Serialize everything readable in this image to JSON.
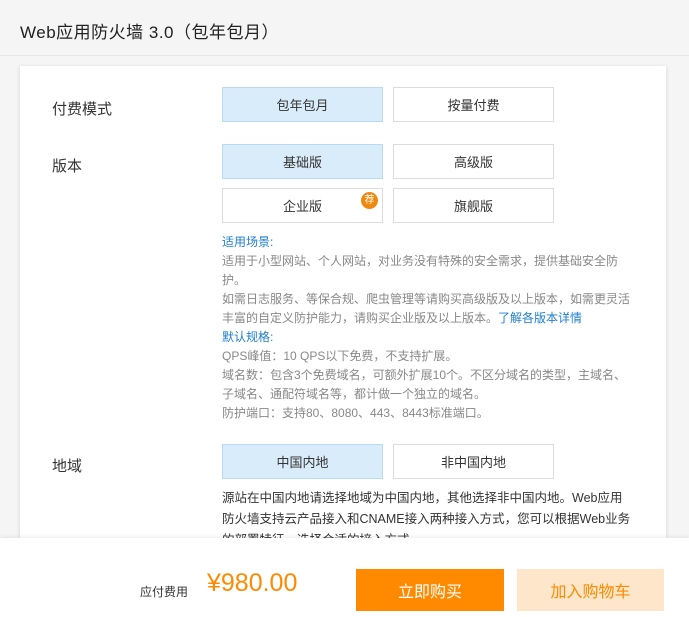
{
  "header": {
    "title": "Web应用防火墙 3.0（包年包月）"
  },
  "form": {
    "billing": {
      "label": "付费模式",
      "options": [
        "包年包月",
        "按量付费"
      ],
      "selected": "包年包月"
    },
    "edition": {
      "label": "版本",
      "options": [
        "基础版",
        "高级版",
        "企业版",
        "旗舰版"
      ],
      "selected": "基础版",
      "recommend_badge": "荐"
    },
    "edition_info": {
      "scenario_title": "适用场景:",
      "scenario_text": "适用于小型网站、个人网站，对业务没有特殊的安全需求，提供基础安全防护。",
      "upgrade_text": "如需日志服务、等保合规、爬虫管理等请购买高级版及以上版本，如需更灵活丰富的自定义防护能力，请购买企业版及以上版本。",
      "details_link": "了解各版本详情",
      "spec_title": "默认规格:",
      "qps_text": "QPS峰值：10 QPS以下免费，不支持扩展。",
      "domain_text": "域名数：包含3个免费域名，可额外扩展10个。不区分域名的类型，主域名、子域名、通配符域名等，都计做一个独立的域名。",
      "port_text": "防护端口：支持80、8080、443、8443标准端口。"
    },
    "region": {
      "label": "地域",
      "options": [
        "中国内地",
        "非中国内地"
      ],
      "selected": "中国内地",
      "description": "源站在中国内地请选择地域为中国内地，其他选择非中国内地。Web应用防火墙支持云产品接入和CNAME接入两种接入方式，您可以根据Web业务的部署特征，选择合适的接入方式。"
    }
  },
  "footer": {
    "fee_label": "应付费用",
    "price": "¥980.00",
    "buy_label": "立即购买",
    "cart_label": "加入购物车"
  },
  "colors": {
    "accent": "#ff8a00",
    "link": "#1e7fd0",
    "selected_bg": "#d9ecf9"
  }
}
